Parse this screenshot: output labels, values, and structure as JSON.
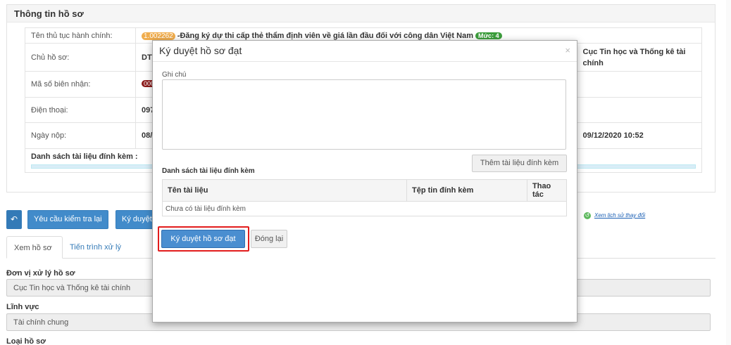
{
  "info": {
    "title": "Thông tin hồ sơ",
    "procedure_label": "Tên thủ tục hành chính:",
    "procedure_code": "1.002262",
    "procedure_name": " -Đăng ký dự thi cấp thẻ thẩm định viên về giá lần đầu đối với công dân Việt Nam ",
    "procedure_level": "Mức: 4",
    "owner_label": "Chủ hồ sơ:",
    "owner_value": "DTT",
    "owner_agency": "Cục Tin học và Thống kê tài chính",
    "receipt_label": "Mã số biên nhận:",
    "receipt_value": "000.00",
    "phone_label": "Điện thoại:",
    "phone_value": "0975",
    "date_label": "Ngày nộp:",
    "date_value": "08/12",
    "date_right": "09/12/2020 10:52",
    "docs_label": "Danh sách tài liệu đính kèm :"
  },
  "toolbar": {
    "request_check_label": "Yêu cầu kiểm tra lại",
    "sign_approve_label": "Ký duyệt",
    "history_link": "Xem lịch sử thay đổi"
  },
  "tabs": [
    {
      "label": "Xem hồ sơ"
    },
    {
      "label": "Tiến trình xử lý"
    }
  ],
  "fields": {
    "unit_label": "Đơn vị xử lý hồ sơ",
    "unit_value": "Cục Tin học và Thống kê tài chính",
    "domain_label": "Lĩnh vực",
    "domain_value": "Tài chính chung",
    "type_label": "Loại hồ sơ"
  },
  "modal": {
    "title": "Ký duyệt hồ sơ đạt",
    "close_glyph": "×",
    "note_label": "Ghi chú",
    "add_doc_label": "Thêm tài liệu đính kèm",
    "docs_title": "Danh sách tài liệu đính kèm",
    "columns": [
      "Tên tài liệu",
      "Tệp tin đính kèm",
      "Thao tác"
    ],
    "empty_text": "Chưa có tài liệu đính kèm",
    "approve_label": "Ký duyệt hồ sơ đạt",
    "close_label": "Đóng lại"
  }
}
